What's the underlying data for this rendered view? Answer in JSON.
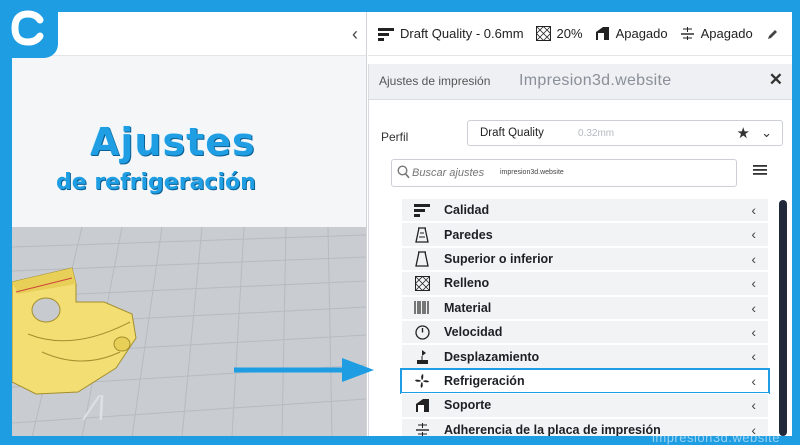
{
  "overlay": {
    "title": "Ajustes",
    "subtitle": "de refrigeración",
    "watermark_corner": "impresion3d.website"
  },
  "toolbar": {
    "quality": "Draft Quality - 0.6mm",
    "infill": "20%",
    "support": "Apagado",
    "adhesion": "Apagado"
  },
  "panel": {
    "title": "Ajustes de impresión",
    "watermark": "Impresion3d.website",
    "close_glyph": "✕",
    "profile_label": "Perfil",
    "profile_value": "Draft Quality",
    "profile_layer": "0.32mm",
    "search_placeholder": "Buscar ajustes",
    "search_watermark": "impresion3d.website"
  },
  "categories": [
    {
      "label": "Calidad",
      "icon": "quality-icon"
    },
    {
      "label": "Paredes",
      "icon": "walls-icon"
    },
    {
      "label": "Superior o inferior",
      "icon": "top-bottom-icon"
    },
    {
      "label": "Relleno",
      "icon": "infill-icon"
    },
    {
      "label": "Material",
      "icon": "material-icon"
    },
    {
      "label": "Velocidad",
      "icon": "speed-icon"
    },
    {
      "label": "Desplazamiento",
      "icon": "travel-icon"
    },
    {
      "label": "Refrigeración",
      "icon": "cooling-fan-icon"
    },
    {
      "label": "Soporte",
      "icon": "support-icon"
    },
    {
      "label": "Adherencia de la placa de impresión",
      "icon": "adhesion-icon"
    }
  ],
  "highlighted_category": "Refrigeración",
  "colors": {
    "accent_blue": "#1e9de3",
    "model_yellow": "#f3de74",
    "scrollbar": "#20293a"
  }
}
